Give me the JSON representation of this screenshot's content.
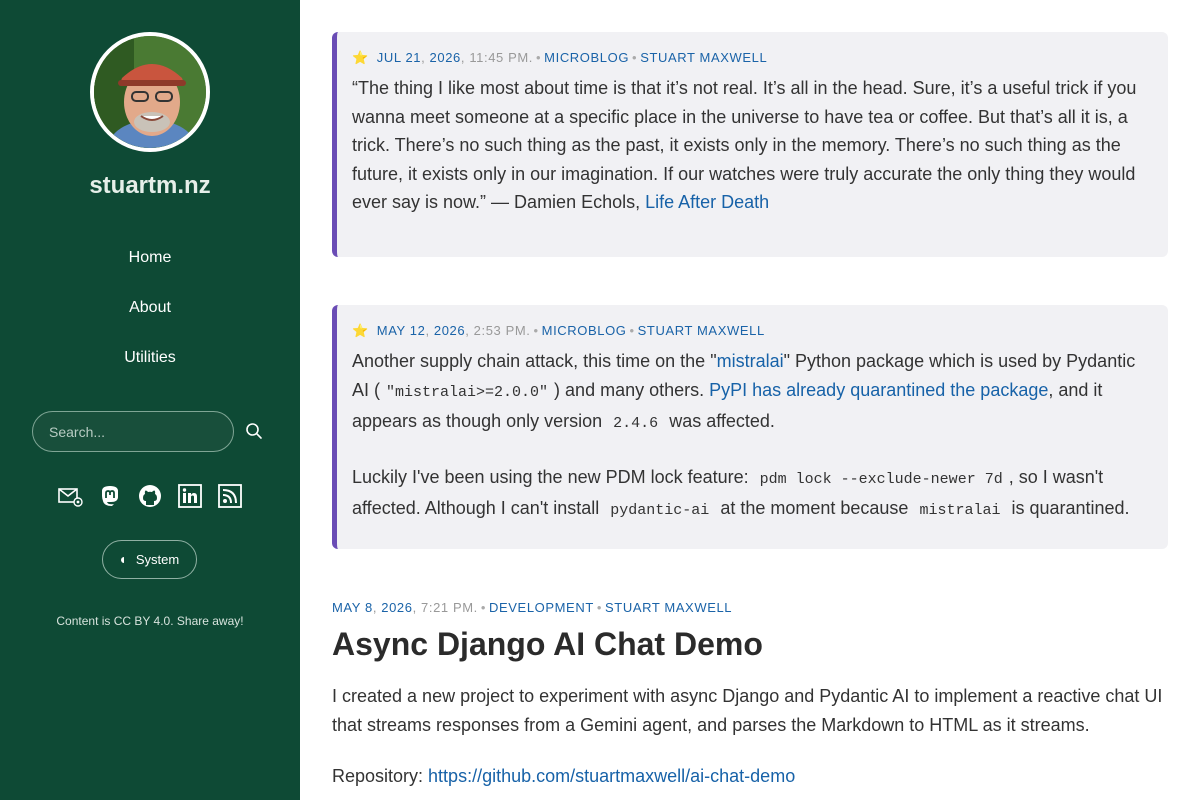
{
  "site": {
    "title": "stuartm.nz",
    "nav": [
      "Home",
      "About",
      "Utilities"
    ],
    "search_placeholder": "Search...",
    "social_icons": [
      "email-icon",
      "mastodon-icon",
      "github-icon",
      "linkedin-icon",
      "rss-icon"
    ],
    "theme_label": "System",
    "license": "Content is CC BY 4.0. Share away!"
  },
  "posts": [
    {
      "date": "JUL 21",
      "year": "2026",
      "time": "11:45 PM.",
      "category": "MICROBLOG",
      "author": "STUART MAXWELL",
      "quote": "“The thing I like most about time is that it’s not real. It’s all in the head. Sure, it’s a useful trick if you wanna meet someone at a specific place in the universe to have tea or coffee. But that’s all it is, a trick. There’s no such thing as the past, it exists only in the memory. There’s no such thing as the future, it exists only in our imagination. If our watches were truly accurate the only thing they would ever say is now.” — Damien Echols, ",
      "quote_link": "Life After Death"
    },
    {
      "date": "MAY 12",
      "year": "2026",
      "time": "2:53 PM.",
      "category": "MICROBLOG",
      "author": "STUART MAXWELL",
      "p1_a": "Another supply chain attack, this time on the \"",
      "p1_link1": "mistralai",
      "p1_b": "\" Python package which is used by Pydantic AI (",
      "p1_code1": "\"mistralai>=2.0.0\"",
      "p1_c": ") and many others. ",
      "p1_link2": "PyPI has already quarantined the package",
      "p1_d": ", and it appears as though only version ",
      "p1_code2": "2.4.6",
      "p1_e": " was affected.",
      "p2_a": "Luckily I've been using the new PDM lock feature: ",
      "p2_code1": "pdm lock --exclude-newer 7d",
      "p2_b": ", so I wasn't affected. Although I can't install ",
      "p2_code2": "pydantic-ai",
      "p2_c": " at the moment because ",
      "p2_code3": "mistralai",
      "p2_d": " is quarantined."
    },
    {
      "date": "MAY 8",
      "year": "2026",
      "time": "7:21 PM.",
      "category": "DEVELOPMENT",
      "author": "STUART MAXWELL",
      "title": "Async Django AI Chat Demo",
      "body": "I created a new project to experiment with async Django and Pydantic AI to implement a reactive chat UI that streams responses from a Gemini agent, and parses the Markdown to HTML as it streams.",
      "repo_label": "Repository: ",
      "repo_link": "https://github.com/stuartmaxwell/ai-chat-demo"
    }
  ]
}
